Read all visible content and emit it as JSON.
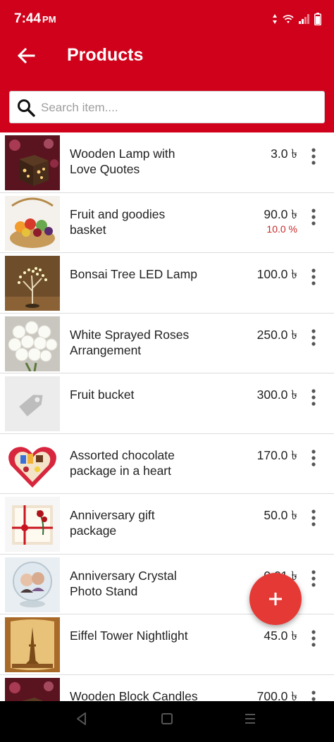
{
  "status_bar": {
    "time": "7:44",
    "ampm": "PM"
  },
  "app_bar": {
    "title": "Products"
  },
  "search": {
    "placeholder": "Search item...."
  },
  "products": [
    {
      "name": "Wooden Lamp with Love Quotes",
      "price": "3.0 ৳",
      "discount": "",
      "thumb": "lamp-box"
    },
    {
      "name": "Fruit and goodies basket",
      "price": "90.0 ৳",
      "discount": "10.0 %",
      "thumb": "fruit-basket"
    },
    {
      "name": "Bonsai Tree LED Lamp",
      "price": "100.0 ৳",
      "discount": "",
      "thumb": "bonsai"
    },
    {
      "name": "White Sprayed Roses Arrangement",
      "price": "250.0 ৳",
      "discount": "",
      "thumb": "roses"
    },
    {
      "name": "Fruit bucket",
      "price": "300.0 ৳",
      "discount": "",
      "thumb": "placeholder-tag"
    },
    {
      "name": "Assorted chocolate package in a heart",
      "price": "170.0 ৳",
      "discount": "",
      "thumb": "heart-box"
    },
    {
      "name": "Anniversary gift package",
      "price": "50.0 ৳",
      "discount": "",
      "thumb": "gift-package"
    },
    {
      "name": "Anniversary Crystal Photo Stand",
      "price": "0.01 ৳",
      "discount": "",
      "thumb": "crystal-photo"
    },
    {
      "name": "Eiffel Tower Nightlight",
      "price": "45.0 ৳",
      "discount": "",
      "thumb": "eiffel"
    },
    {
      "name": "Wooden Block Candles",
      "price": "700.0 ৳",
      "discount": "",
      "thumb": "lamp-box"
    }
  ],
  "colors": {
    "primary": "#d0021b",
    "fab": "#e53935",
    "discount": "#c62828"
  },
  "icons": {
    "back": "arrow-left-icon",
    "search": "search-icon",
    "more": "more-vertical-icon",
    "fab": "plus-icon"
  }
}
